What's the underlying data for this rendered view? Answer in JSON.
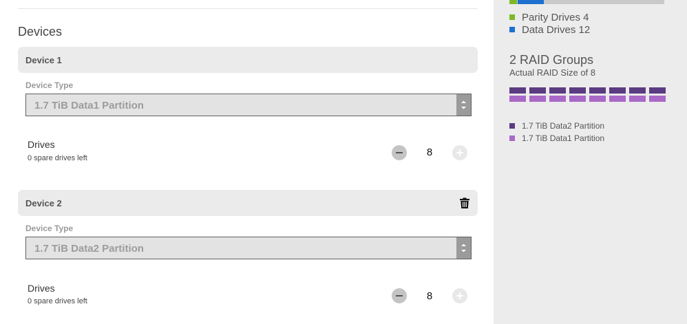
{
  "main": {
    "section_title": "Devices",
    "devices": [
      {
        "title": "Device 1",
        "field_label": "Device Type",
        "device_type": "1.7 TiB Data1 Partition",
        "drives_label": "Drives",
        "spare_text": "0 spare drives left",
        "drives_count": "8",
        "deletable": false
      },
      {
        "title": "Device 2",
        "field_label": "Device Type",
        "device_type": "1.7 TiB Data2 Partition",
        "drives_label": "Drives",
        "spare_text": "0 spare drives left",
        "drives_count": "8",
        "deletable": true
      }
    ]
  },
  "sidebar": {
    "usage_bar": {
      "parity_fraction": 0.05,
      "data_fraction": 0.17,
      "parity_color": "#7db828",
      "data_color": "#1d6fd0"
    },
    "legend": [
      {
        "label": "Parity Drives 4",
        "color": "#7db828"
      },
      {
        "label": "Data Drives 12",
        "color": "#1d6fd0"
      }
    ],
    "raid_title": "2 RAID Groups",
    "raid_subtitle": "Actual RAID Size of 8",
    "raid_groups": [
      {
        "color": "#5b3b82",
        "count": 8
      },
      {
        "color": "#a969c6",
        "count": 8
      }
    ],
    "partition_legend": [
      {
        "label": "1.7 TiB Data2 Partition",
        "color": "#5b3b82"
      },
      {
        "label": "1.7 TiB Data1 Partition",
        "color": "#a969c6"
      }
    ]
  },
  "icons": {
    "trash": "trash-icon",
    "minus": "minus-icon",
    "plus": "plus-icon",
    "select_arrows": "up-down-arrows-icon"
  }
}
